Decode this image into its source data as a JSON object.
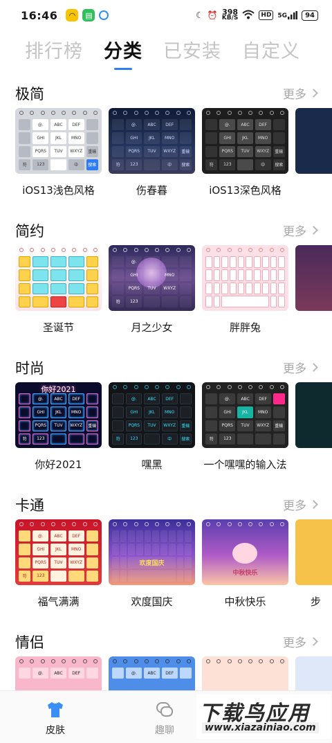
{
  "status_bar": {
    "time": "16:46",
    "net_speed_value": "398",
    "net_speed_unit": "KB/S",
    "hd_label": "HD",
    "signal_label": "5G",
    "battery": "94"
  },
  "tabs": [
    "排行榜",
    "分类",
    "已安装",
    "自定义"
  ],
  "sections": [
    {
      "title": "极简",
      "more": "更多",
      "cards": [
        "iOS13浅色风格",
        "伤春暮",
        "iOS13深色风格",
        ""
      ]
    },
    {
      "title": "简约",
      "more": "更多",
      "cards": [
        "圣诞节",
        "月之少女",
        "胖胖兔",
        ""
      ]
    },
    {
      "title": "时尚",
      "more": "更多",
      "cards": [
        "你好2021",
        "嘿黑",
        "一个嘿嘿的输入法",
        ""
      ]
    },
    {
      "title": "卡通",
      "more": "更多",
      "cards": [
        "福气满满",
        "欢度国庆",
        "中秋快乐",
        "步"
      ]
    },
    {
      "title": "情侣",
      "more": "更多",
      "cards": [
        "",
        "",
        "",
        ""
      ]
    }
  ],
  "keyboard_keys": [
    "@.",
    "ABC",
    "DEF",
    "GHI",
    "JKL",
    "MNO",
    "PQRS",
    "TUV",
    "WXYZ",
    "符",
    "123",
    "中",
    "搜索",
    "重输"
  ],
  "thumb_texts": {
    "hello2021": "你好2021",
    "mid_autumn": "中秋快乐",
    "national_day": "欢度国庆"
  },
  "bottom_nav": {
    "skin": "皮肤",
    "fun_chat": "趣聊"
  },
  "watermark": {
    "main": "下载鸟应用",
    "url": "www.xiazainiao.com"
  },
  "colors": {
    "accent": "#2e7cf6",
    "inactive_tab": "#c4c4c4",
    "more_text": "#a8a8a8"
  }
}
